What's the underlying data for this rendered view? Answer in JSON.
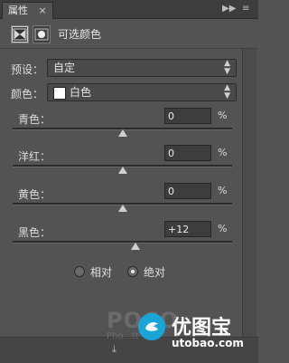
{
  "panel": {
    "tab_label": "属性",
    "tab_close": "×",
    "toolbar_icons": [
      "expand-icon",
      "menu-icon"
    ],
    "title": "可选颜色"
  },
  "preset": {
    "label": "预设：",
    "value": "自定"
  },
  "colors": {
    "label": "颜色：",
    "value": "白色",
    "swatch": "#ffffff"
  },
  "sliders": [
    {
      "label": "青色：",
      "value": "0",
      "unit": "%",
      "level": 0.5
    },
    {
      "label": "洋红：",
      "value": "0",
      "unit": "%",
      "level": 0.5
    },
    {
      "label": "黄色：",
      "value": "0",
      "unit": "%",
      "level": 0.5
    },
    {
      "label": "黑色：",
      "value": "+12",
      "unit": "%",
      "level": 0.56
    }
  ],
  "method": {
    "relative_label": "相对",
    "absolute_label": "绝对",
    "selected": "absolute"
  },
  "watermark": {
    "left_text": "POCO",
    "left_sub": "Pho...tt",
    "title": "优图宝",
    "url": "utobao.com"
  }
}
